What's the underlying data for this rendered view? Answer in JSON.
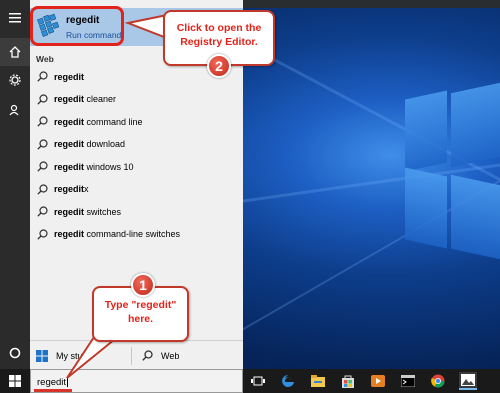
{
  "best_match": {
    "title": "regedit",
    "subtitle": "Run command",
    "icon": "registry-editor-icon"
  },
  "web_section": {
    "heading": "Web",
    "results": [
      {
        "bold": "regedit",
        "rest": ""
      },
      {
        "bold": "regedit",
        "rest": " cleaner"
      },
      {
        "bold": "regedit",
        "rest": " command line"
      },
      {
        "bold": "regedit",
        "rest": " download"
      },
      {
        "bold": "regedit",
        "rest": " windows 10"
      },
      {
        "bold": "regedit",
        "rest": "x"
      },
      {
        "bold": "regedit",
        "rest": " switches"
      },
      {
        "bold": "regedit",
        "rest": " command-line switches"
      }
    ]
  },
  "bottom_bar": {
    "my_stuff_label": "My stuff",
    "web_label": "Web"
  },
  "search": {
    "value": "regedit"
  },
  "callouts": {
    "open": {
      "text_line1": "Click to open the",
      "text_line2": "Registry Editor.",
      "badge": "2"
    },
    "type": {
      "text_line1": "Type \"regedit\"",
      "text_line2": "here.",
      "badge": "1"
    }
  },
  "colors": {
    "accent_red": "#e2231a",
    "selection_blue": "#a9c7e6",
    "taskbar": "#1a1a1a"
  }
}
